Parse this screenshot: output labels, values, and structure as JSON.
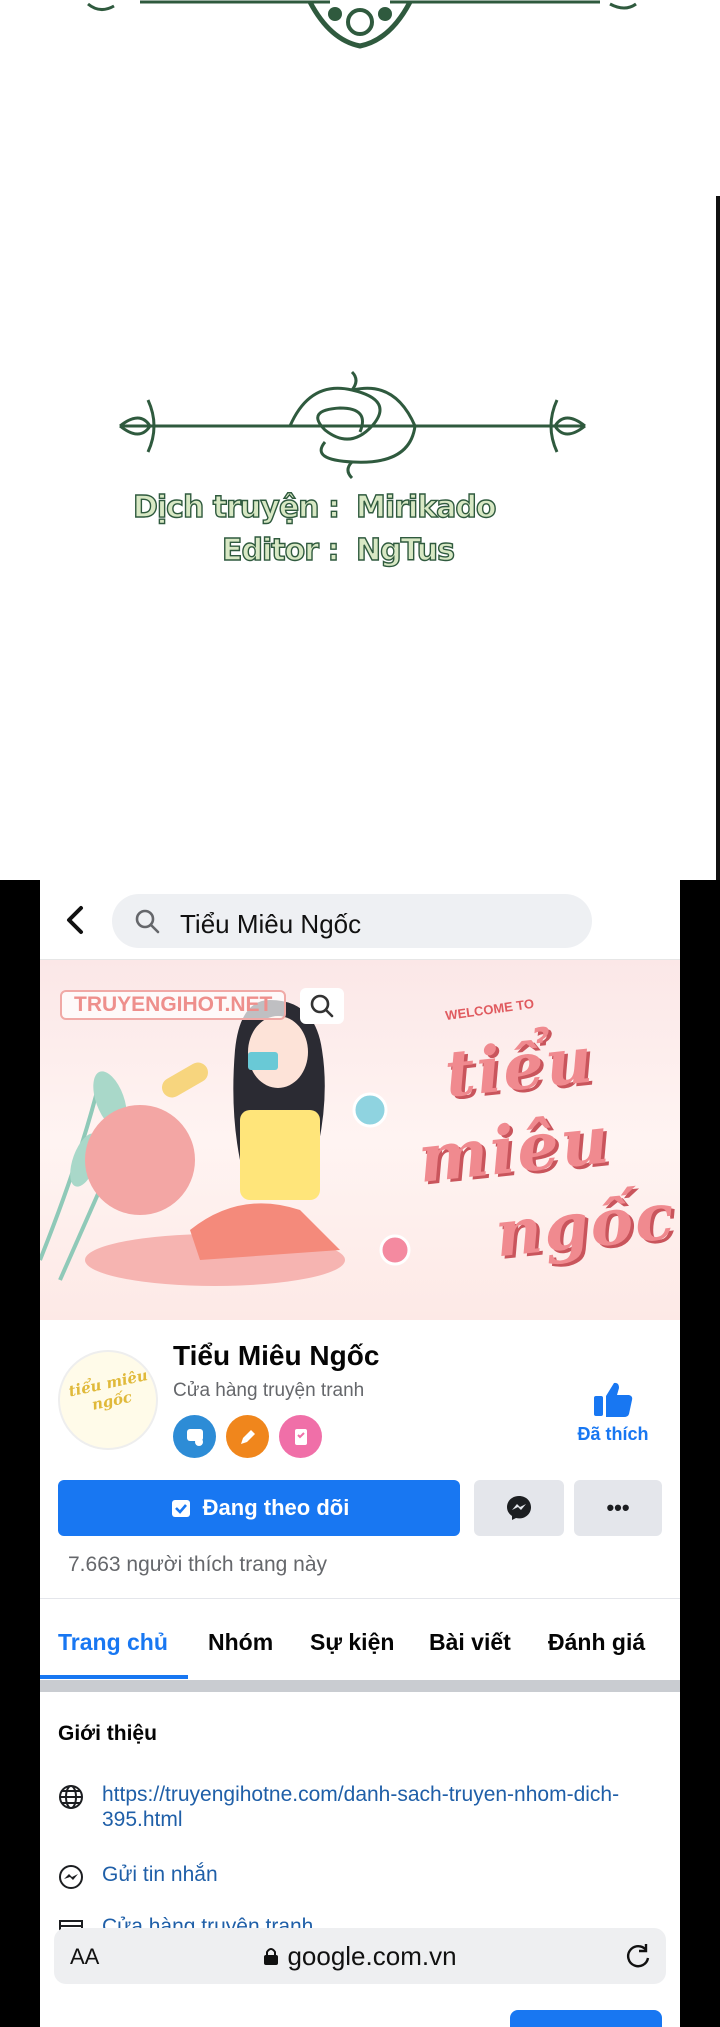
{
  "credits": {
    "translator_role": "Dịch truyện :",
    "translator_name": "Mirikado",
    "editor_role": "Editor :",
    "editor_name": "NgTus"
  },
  "search": {
    "query": "Tiểu Miêu Ngốc"
  },
  "banner": {
    "site_label": "TRUYENGIHOT.NET",
    "welcome": "WELCOME TO",
    "title_line1": "tiểu",
    "title_line2": "miêu",
    "title_line3": "ngốc"
  },
  "profile": {
    "name": "Tiểu Miêu Ngốc",
    "category": "Cửa hàng truyện tranh",
    "avatar_text": "tiểu miêu ngốc",
    "like_label": "Đã thích"
  },
  "actions": {
    "follow_label": "Đang theo dõi",
    "more_label": "•••"
  },
  "likes_count": "7.663 người thích trang này",
  "tabs": [
    {
      "label": "Trang chủ",
      "active": true
    },
    {
      "label": "Nhóm",
      "active": false
    },
    {
      "label": "Sự kiện",
      "active": false
    },
    {
      "label": "Bài viết",
      "active": false
    },
    {
      "label": "Đánh giá",
      "active": false
    }
  ],
  "intro": {
    "title": "Giới thiệu",
    "website": "https://truyengihotne.com/danh-sach-truyen-nhom-dich-395.html",
    "message": "Gửi tin nhắn",
    "category": "Cửa hàng truyện tranh"
  },
  "browser": {
    "text_size": "AA",
    "domain": "google.com.vn"
  },
  "colors": {
    "facebook_blue": "#1877f2",
    "credit_green": "#2f5a3e",
    "banner_pink": "#f08a8f"
  }
}
